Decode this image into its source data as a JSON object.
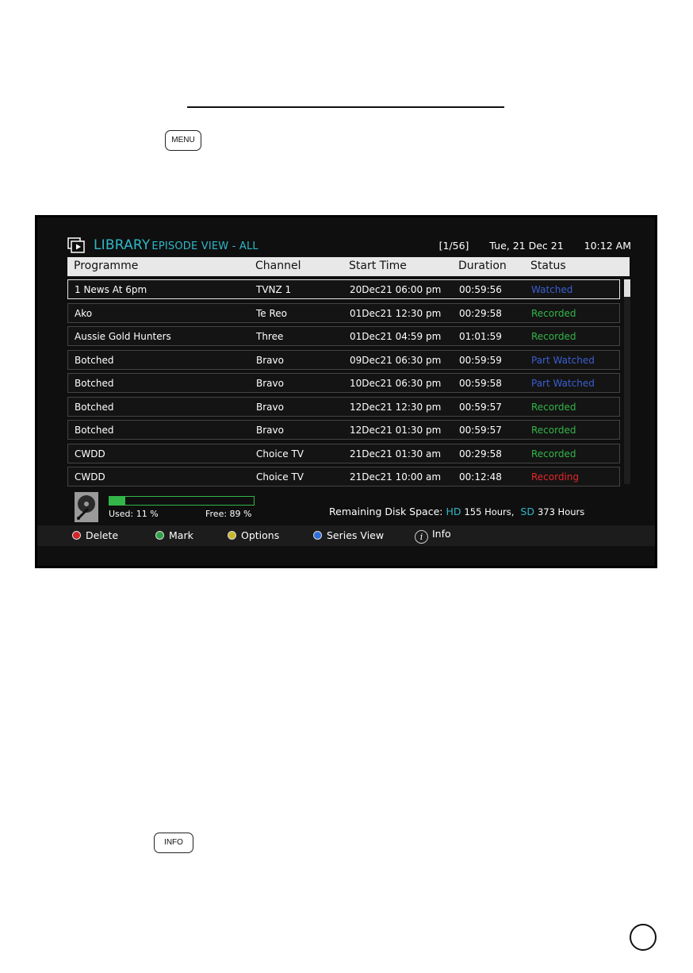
{
  "doc": {
    "menu_key": "MENU",
    "info_key": "INFO"
  },
  "screen": {
    "title": "LIBRARY",
    "subtitle": "EPISODE VIEW - ALL",
    "page_indicator": "[1/56]",
    "date": "Tue, 21 Dec 21",
    "time": "10:12 AM",
    "columns": [
      "Programme",
      "Channel",
      "Start Time",
      "Duration",
      "Status"
    ],
    "rows": [
      {
        "programme": "1 News At 6pm",
        "channel": "TVNZ 1",
        "start": "20Dec21 06:00 pm",
        "duration": "00:59:56",
        "status": "Watched"
      },
      {
        "programme": "Ako",
        "channel": "Te Reo",
        "start": "01Dec21 12:30 pm",
        "duration": "00:29:58",
        "status": "Recorded"
      },
      {
        "programme": "Aussie Gold Hunters",
        "channel": "Three",
        "start": "01Dec21 04:59 pm",
        "duration": "01:01:59",
        "status": "Recorded"
      },
      {
        "programme": "Botched",
        "channel": "Bravo",
        "start": "09Dec21 06:30 pm",
        "duration": "00:59:59",
        "status": "Part Watched"
      },
      {
        "programme": "Botched",
        "channel": "Bravo",
        "start": "10Dec21 06:30 pm",
        "duration": "00:59:58",
        "status": "Part Watched"
      },
      {
        "programme": "Botched",
        "channel": "Bravo",
        "start": "12Dec21 12:30 pm",
        "duration": "00:59:57",
        "status": "Recorded"
      },
      {
        "programme": "Botched",
        "channel": "Bravo",
        "start": "12Dec21 01:30 pm",
        "duration": "00:59:57",
        "status": "Recorded"
      },
      {
        "programme": "CWDD",
        "channel": "Choice TV",
        "start": "21Dec21 01:30 am",
        "duration": "00:29:58",
        "status": "Recorded"
      },
      {
        "programme": "CWDD",
        "channel": "Choice TV",
        "start": "21Dec21 10:00 am",
        "duration": "00:12:48",
        "status": "Recording"
      }
    ],
    "disk": {
      "used_percent": 11,
      "used_label": "Used: 11 %",
      "free_label": "Free: 89 %",
      "remaining_label": "Remaining Disk Space:",
      "hd_tag": "HD",
      "hd_value": "155 Hours,",
      "sd_tag": "SD",
      "sd_value": "373 Hours"
    },
    "footer": {
      "delete": "Delete",
      "mark": "Mark",
      "options": "Options",
      "series_view": "Series View",
      "info": "Info"
    },
    "colors": {
      "accent": "#2fb7c8",
      "watched": "#3b5ed0",
      "recorded": "#33b549",
      "recording": "#e2262b"
    }
  }
}
